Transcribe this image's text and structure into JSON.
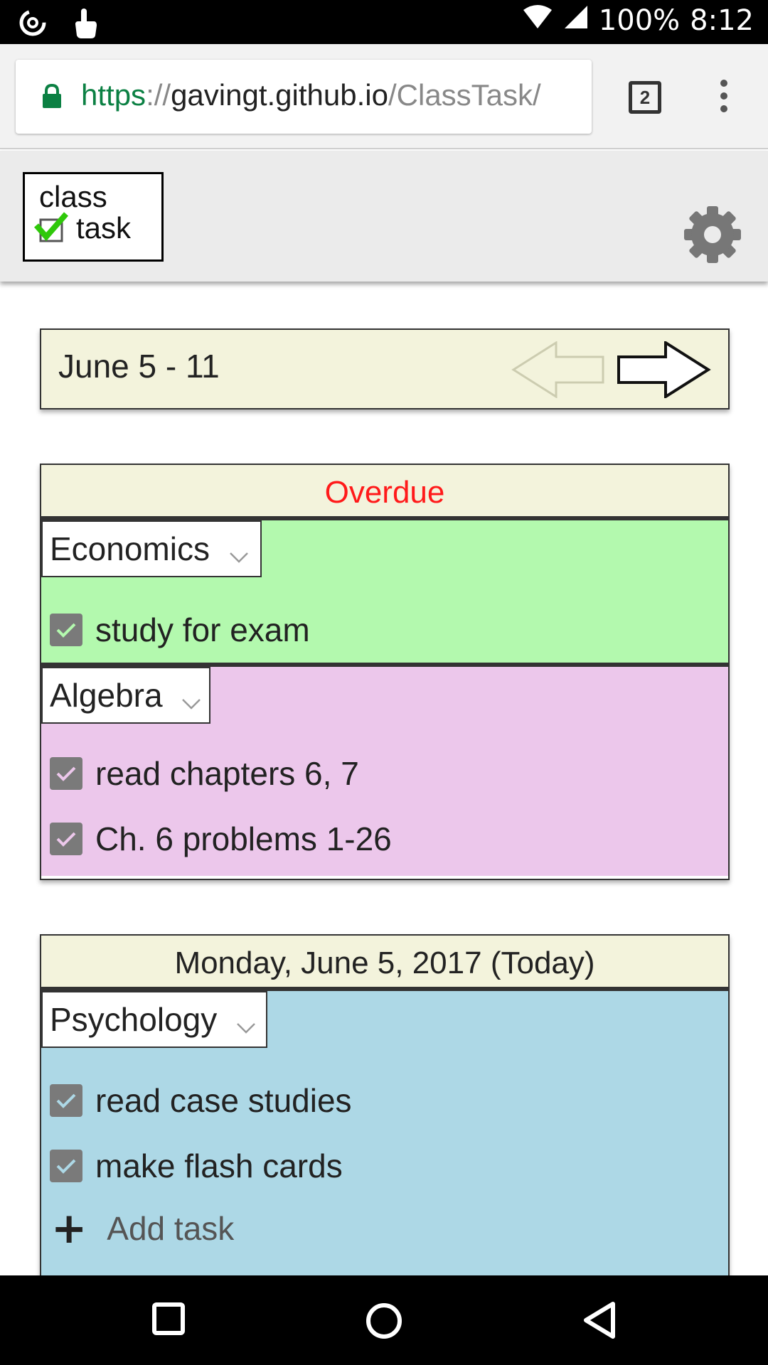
{
  "status_bar": {
    "battery": "100%",
    "time": "8:12"
  },
  "browser": {
    "url_scheme": "https",
    "url_separator": "://",
    "url_host": "gavingt.github.io",
    "url_path": "/ClassTask/",
    "tab_count": "2"
  },
  "app": {
    "logo_line1": "class",
    "logo_line2": "task"
  },
  "week_nav": {
    "range_label": "June 5 - 11"
  },
  "overdue": {
    "header": "Overdue",
    "classes": [
      {
        "name": "Economics",
        "color": "#b3f9ae",
        "tasks": [
          "study for exam"
        ]
      },
      {
        "name": "Algebra",
        "color": "#ecc7eb",
        "tasks": [
          "read chapters 6, 7",
          "Ch. 6 problems 1-26"
        ]
      }
    ]
  },
  "today": {
    "header": "Monday, June 5, 2017 (Today)",
    "classes": [
      {
        "name": "Psychology",
        "color": "#add8e6",
        "tasks": [
          "read case studies",
          "make flash cards"
        ]
      }
    ],
    "add_task_label": "Add task"
  },
  "colors": {
    "overdue_text": "#ff1a1a",
    "header_bg": "#f3f3dc",
    "checkbox_gray": "#7a7a7a",
    "secure_green": "#0b8043"
  }
}
